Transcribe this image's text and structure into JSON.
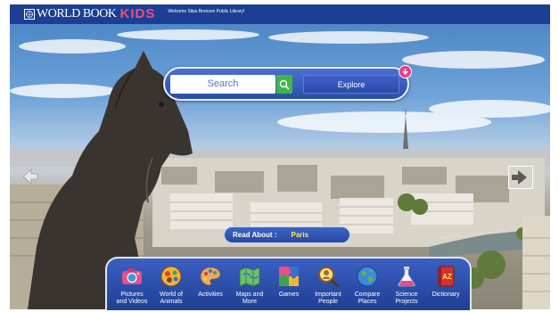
{
  "header": {
    "logo_world_book": "WORLD BOOK",
    "logo_kids": "KIDS",
    "welcome": "Welcome Silas Bronson Public Library!"
  },
  "search": {
    "placeholder": "Search",
    "explore_label": "Explore"
  },
  "read_about": {
    "label": "Read About :",
    "value": "Paris"
  },
  "nav": {
    "items": [
      {
        "line1": "Pictures",
        "line2": "and Videos",
        "icon": "camera-icon"
      },
      {
        "line1": "World of",
        "line2": "Animals",
        "icon": "animals-icon"
      },
      {
        "line1": "Activities",
        "line2": "",
        "icon": "palette-icon"
      },
      {
        "line1": "Maps and",
        "line2": "More",
        "icon": "map-icon"
      },
      {
        "line1": "Games",
        "line2": "",
        "icon": "puzzle-icon"
      },
      {
        "line1": "Important",
        "line2": "People",
        "icon": "magnifier-icon"
      },
      {
        "line1": "Compare",
        "line2": "Places",
        "icon": "globe-icon"
      },
      {
        "line1": "Science",
        "line2": "Projects",
        "icon": "flask-icon"
      },
      {
        "line1": "Dictionary",
        "line2": "",
        "icon": "dictionary-icon"
      }
    ]
  },
  "colors": {
    "brand_blue": "#1c3f94",
    "kids_pink": "#ef4e7b",
    "search_green": "#3fb54a",
    "pin_pink": "#ea3d86",
    "read_value_yellow": "#ffe95c"
  }
}
